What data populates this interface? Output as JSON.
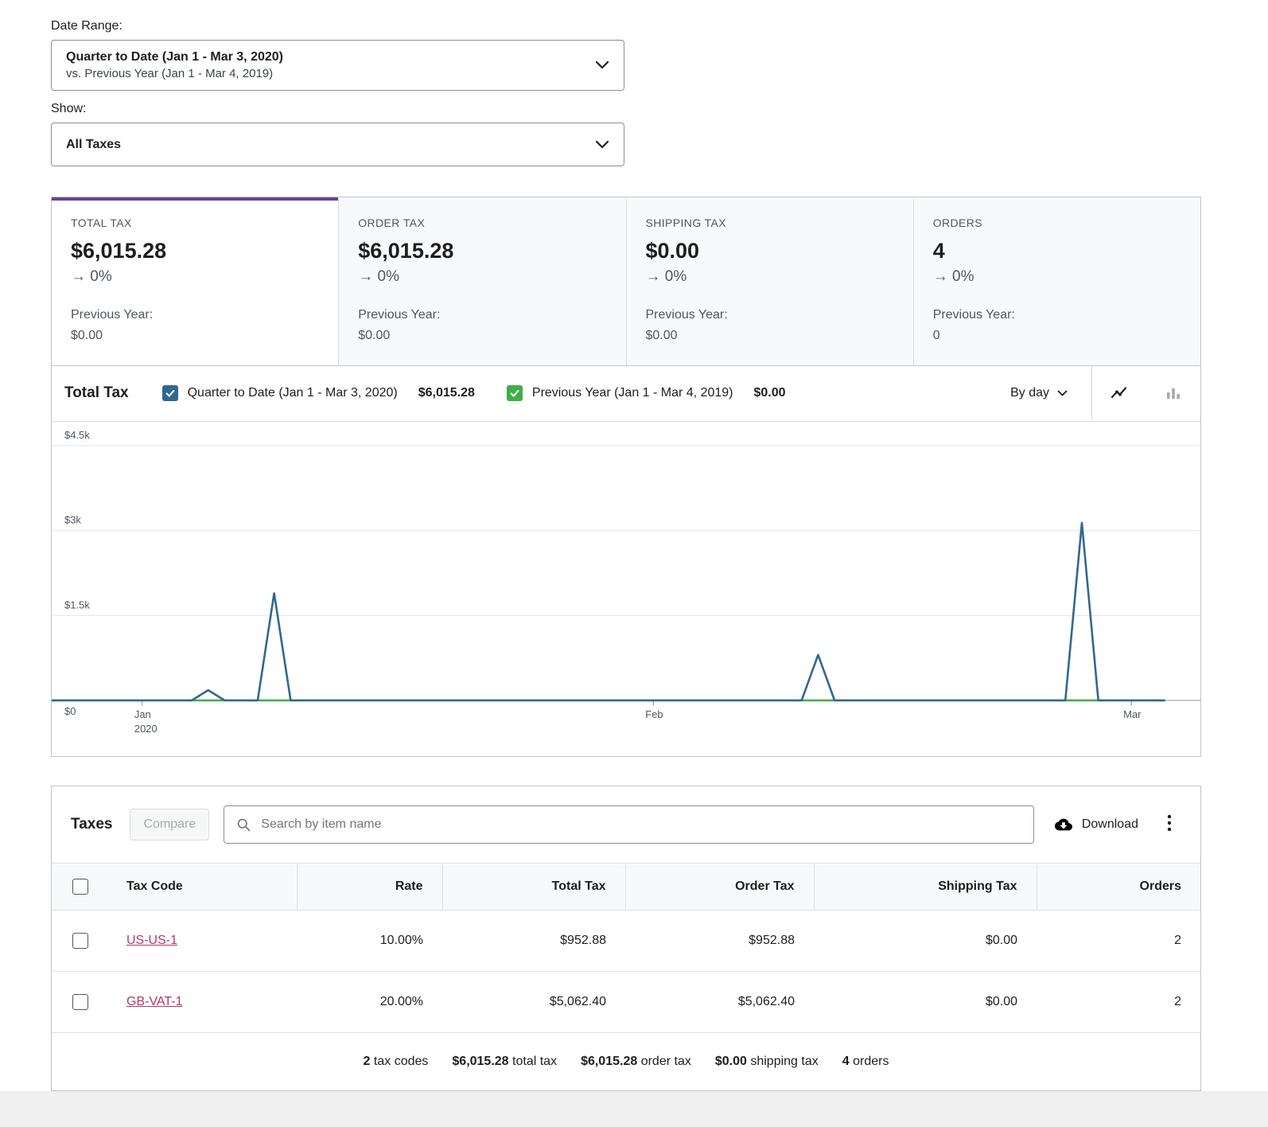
{
  "filters": {
    "date_range_label": "Date Range:",
    "date_range_primary": "Quarter to Date (Jan 1 - Mar 3, 2020)",
    "date_range_secondary": "vs. Previous Year (Jan 1 - Mar 4, 2019)",
    "show_label": "Show:",
    "show_value": "All Taxes"
  },
  "summary_cards": [
    {
      "label": "TOTAL TAX",
      "value": "$6,015.28",
      "delta": "→ 0%",
      "prev_label": "Previous Year:",
      "prev_value": "$0.00"
    },
    {
      "label": "ORDER TAX",
      "value": "$6,015.28",
      "delta": "→ 0%",
      "prev_label": "Previous Year:",
      "prev_value": "$0.00"
    },
    {
      "label": "SHIPPING TAX",
      "value": "$0.00",
      "delta": "→ 0%",
      "prev_label": "Previous Year:",
      "prev_value": "$0.00"
    },
    {
      "label": "ORDERS",
      "value": "4",
      "delta": "→ 0%",
      "prev_label": "Previous Year:",
      "prev_value": "0"
    }
  ],
  "chart": {
    "title": "Total Tax",
    "legend": [
      {
        "label": "Quarter to Date (Jan 1 - Mar 3, 2020)",
        "total": "$6,015.28",
        "color": "#31688f",
        "checked": true
      },
      {
        "label": "Previous Year (Jan 1 - Mar 4, 2019)",
        "total": "$0.00",
        "color": "#3fae49",
        "checked": true
      }
    ],
    "interval_label": "By day"
  },
  "chart_data": {
    "type": "line",
    "title": "Total Tax",
    "interval": "day",
    "x_start": "Jan 1, 2020",
    "x_end": "Mar 3, 2020",
    "y_ticks": [
      "$4.5k",
      "$3k",
      "$1.5k",
      "$0"
    ],
    "y_tick_values": [
      4500,
      3000,
      1500,
      0
    ],
    "ylim": [
      0,
      5000
    ],
    "x_ticks": [
      {
        "label": "Jan",
        "sublabel": "2020",
        "day": 0
      },
      {
        "label": "Feb",
        "day": 31
      },
      {
        "label": "Mar",
        "day": 60
      }
    ],
    "series": [
      {
        "name": "Quarter to Date (Jan 1 - Mar 3, 2020)",
        "total": 6015.28,
        "color": "#31688f",
        "values": [
          0,
          0,
          0,
          0,
          181,
          0,
          0,
          0,
          1893,
          0,
          0,
          0,
          0,
          0,
          0,
          0,
          0,
          0,
          0,
          0,
          0,
          0,
          0,
          0,
          0,
          0,
          0,
          0,
          0,
          0,
          0,
          0,
          0,
          0,
          0,
          0,
          0,
          0,
          0,
          0,
          0,
          804,
          0,
          0,
          0,
          0,
          0,
          0,
          0,
          0,
          0,
          0,
          0,
          0,
          0,
          0,
          0,
          3137.28,
          0,
          0,
          0,
          0,
          0
        ]
      },
      {
        "name": "Previous Year (Jan 1 - Mar 4, 2019)",
        "total": 0,
        "color": "#3fae49",
        "values": [
          0,
          0,
          0,
          0,
          0,
          0,
          0,
          0,
          0,
          0,
          0,
          0,
          0,
          0,
          0,
          0,
          0,
          0,
          0,
          0,
          0,
          0,
          0,
          0,
          0,
          0,
          0,
          0,
          0,
          0,
          0,
          0,
          0,
          0,
          0,
          0,
          0,
          0,
          0,
          0,
          0,
          0,
          0,
          0,
          0,
          0,
          0,
          0,
          0,
          0,
          0,
          0,
          0,
          0,
          0,
          0,
          0,
          0,
          0,
          0,
          0,
          0,
          0
        ]
      }
    ]
  },
  "table": {
    "title": "Taxes",
    "compare_label": "Compare",
    "search_placeholder": "Search by item name",
    "download_label": "Download",
    "headers": [
      "Tax Code",
      "Rate",
      "Total Tax",
      "Order Tax",
      "Shipping Tax",
      "Orders"
    ],
    "rows": [
      {
        "tax_code": "US-US-1",
        "rate": "10.00%",
        "total_tax": "$952.88",
        "order_tax": "$952.88",
        "shipping_tax": "$0.00",
        "orders": "2"
      },
      {
        "tax_code": "GB-VAT-1",
        "rate": "20.00%",
        "total_tax": "$5,062.40",
        "order_tax": "$5,062.40",
        "shipping_tax": "$0.00",
        "orders": "2"
      }
    ],
    "summary": [
      {
        "value": "2",
        "label": "tax codes"
      },
      {
        "value": "$6,015.28",
        "label": "total tax"
      },
      {
        "value": "$6,015.28",
        "label": "order tax"
      },
      {
        "value": "$0.00",
        "label": "shipping tax"
      },
      {
        "value": "4",
        "label": "orders"
      }
    ]
  },
  "colors": {
    "accent_purple": "#674399",
    "primary_series": "#31688f",
    "secondary_series": "#3fae49",
    "link_pink": "#b5366c"
  }
}
